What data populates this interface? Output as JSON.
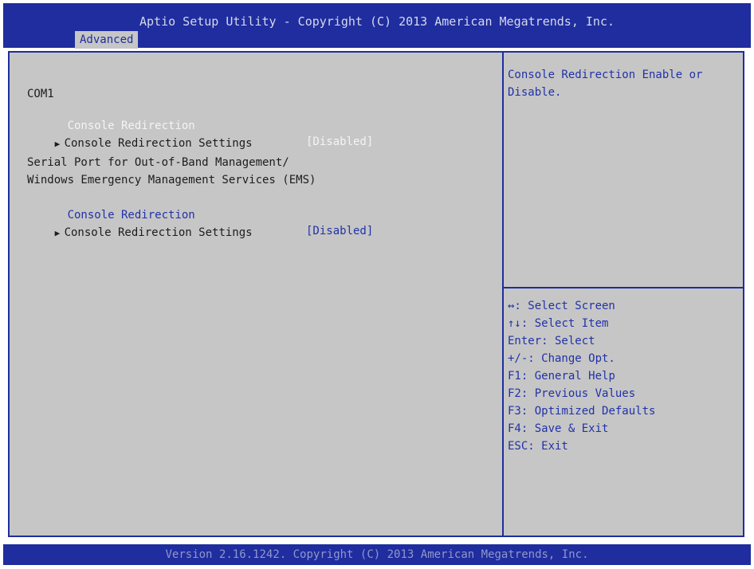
{
  "header": {
    "title": "Aptio Setup Utility - Copyright (C) 2013 American Megatrends, Inc.",
    "active_tab": "Advanced"
  },
  "main": {
    "com1_heading": "COM1",
    "com1_redirection_label": "Console Redirection",
    "com1_redirection_value": "[Disabled]",
    "com1_settings_label": "Console Redirection Settings",
    "ems_heading_line1": "Serial Port for Out-of-Band Management/",
    "ems_heading_line2": "Windows Emergency Management Services (EMS)",
    "ems_redirection_label": "Console Redirection",
    "ems_redirection_value": "[Disabled]",
    "ems_settings_label": "Console Redirection Settings"
  },
  "help": {
    "line1": "Console Redirection Enable or",
    "line2": "Disable."
  },
  "keys": [
    {
      "key": "↔:",
      "desc": " Select Screen"
    },
    {
      "key": "↑↓:",
      "desc": " Select Item"
    },
    {
      "key": "Enter:",
      "desc": " Select"
    },
    {
      "key": "+/-:",
      "desc": " Change Opt."
    },
    {
      "key": "F1:",
      "desc": " General Help"
    },
    {
      "key": "F2:",
      "desc": " Previous Values"
    },
    {
      "key": "F3:",
      "desc": " Optimized Defaults"
    },
    {
      "key": "F4:",
      "desc": " Save & Exit"
    },
    {
      "key": "ESC:",
      "desc": " Exit"
    }
  ],
  "footer": {
    "text": "Version 2.16.1242. Copyright (C) 2013 American Megatrends, Inc."
  },
  "colors": {
    "frame_blue": "#1f2d9e",
    "panel_gray": "#c6c6c6",
    "selected_white": "#f4f4f4",
    "value_blue": "#2132a8"
  }
}
